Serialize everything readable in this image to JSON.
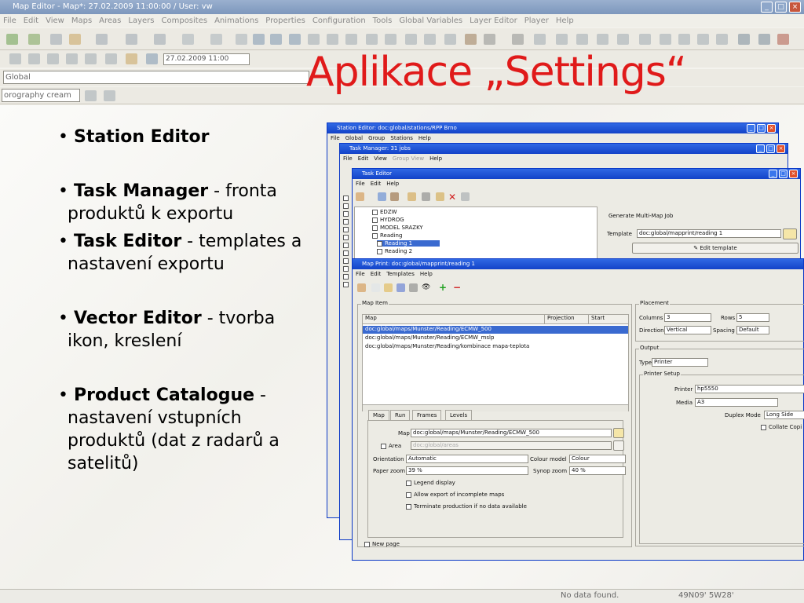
{
  "window": {
    "title": "Map Editor - Map*: 27.02.2009 11:00:00 / User: vw"
  },
  "menu": [
    "File",
    "Edit",
    "View",
    "Maps",
    "Areas",
    "Layers",
    "Composites",
    "Animations",
    "Properties",
    "Configuration",
    "Tools",
    "Global Variables",
    "Layer Editor",
    "Player",
    "Help"
  ],
  "toolbar": {
    "datetime": "27.02.2009 11:00",
    "global_label": "Global",
    "layer_select": "orography cream"
  },
  "status": {
    "message": "No data found.",
    "coords": "49N09' 5W28'"
  },
  "slide": {
    "title": "Aplikace „Settings“",
    "bullets": [
      {
        "bold": "Station Editor",
        "rest": ""
      },
      {
        "bold": "Task Manager",
        "rest": " - fronta produktů k exportu"
      },
      {
        "bold": "Task Editor",
        "rest": " - templates a nastavení exportu"
      },
      {
        "bold": "Vector Editor",
        "rest": " - tvorba ikon, kreslení"
      },
      {
        "bold": "Product Catalogue",
        "rest": " - nastavení vstupních produktů (dat z radarů a satelitů)"
      }
    ]
  },
  "station_editor": {
    "title": "Station Editor: doc:global/stations/RPP Brno",
    "menu": [
      "File",
      "Global",
      "Group",
      "Stations",
      "Help"
    ]
  },
  "task_manager": {
    "title": "Task Manager: 31 jobs",
    "menu": [
      "File",
      "Edit",
      "View",
      "Group View",
      "Help"
    ]
  },
  "task_editor": {
    "title": "Task Editor",
    "menu": [
      "File",
      "Edit",
      "Help"
    ],
    "tree": [
      "EDZW",
      "HYDROG",
      "MODEL SRAZKY",
      "Reading",
      "Reading 1",
      "Reading 2"
    ],
    "job_title": "Generate Multi-Map Job",
    "template_label": "Template",
    "template_value": "doc:global/mapprint/reading 1",
    "edit_template": "Edit template"
  },
  "map_print": {
    "title": "Map Print: doc:global/mapprint/reading 1",
    "menu": [
      "File",
      "Edit",
      "Templates",
      "Help"
    ],
    "map_item_label": "Map Item",
    "columns": [
      "Map",
      "Projection",
      "Start"
    ],
    "rows": [
      "doc:global/maps/Munster/Reading/ECMW_500",
      "doc:global/maps/Munster/Reading/ECMW_mslp",
      "doc:global/maps/Munster/Reading/kombinace mapa-teplota"
    ],
    "tabs": [
      "Map",
      "Run",
      "Frames",
      "Levels"
    ],
    "map_label": "Map",
    "map_value": "doc:global/maps/Munster/Reading/ECMW_500",
    "area_label": "Area",
    "area_value": "doc:global/areas",
    "orientation_label": "Orientation",
    "orientation_value": "Automatic",
    "colour_model_label": "Colour model",
    "colour_model_value": "Colour",
    "paper_zoom_label": "Paper zoom",
    "paper_zoom_value": "39 %",
    "synop_zoom_label": "Synop zoom",
    "synop_zoom_value": "40 %",
    "legend_display": "Legend display",
    "allow_export": "Allow export of incomplete maps",
    "terminate": "Terminate production if no data available",
    "new_page": "New page",
    "placement_label": "Placement",
    "columns_label": "Columns",
    "columns_value": "3",
    "rows_label": "Rows",
    "rows_value": "5",
    "direction_label": "Direction",
    "direction_value": "Vertical",
    "spacing_label": "Spacing",
    "spacing_value": "Default",
    "output_label": "Output",
    "type_label": "Type",
    "type_value": "Printer",
    "printer_setup_label": "Printer Setup",
    "printer_label": "Printer",
    "printer_value": "hp5550",
    "media_label": "Media",
    "media_value": "A3",
    "duplex_label": "Duplex Mode",
    "duplex_value": "Long Side",
    "collate": "Collate Copi"
  }
}
